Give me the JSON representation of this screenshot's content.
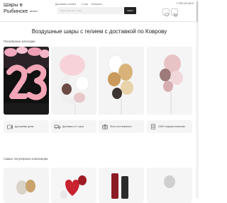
{
  "header": {
    "logo_text": "Шары в Рыбинске",
    "nav": [
      "Доставка и оплата",
      "О нас",
      "Контакты"
    ],
    "catalog_label": "каталог",
    "search_placeholder": "Найти шар или товар",
    "search_button": "Найти",
    "phone": "+7 999 123-45-67"
  },
  "hero": {
    "title": "Воздушные шары с гелием с доставкой по Коврову"
  },
  "categories": {
    "heading": "Популярные категории"
  },
  "features": [
    {
      "label": "Доступные цены",
      "icon": "wallet-icon"
    },
    {
      "label": "Доставка от 1 часа",
      "icon": "delivery-truck-icon"
    },
    {
      "label": "Фото по готовности",
      "icon": "camera-icon"
    },
    {
      "label": "1000+ шаров в наличии",
      "icon": "catalog-icon"
    }
  ],
  "products": {
    "heading": "Самые популярные композиции"
  },
  "colors": {
    "accent": "#222222",
    "balloon_pink": "#f3a6b8",
    "balloon_gold": "#d9b27a"
  }
}
